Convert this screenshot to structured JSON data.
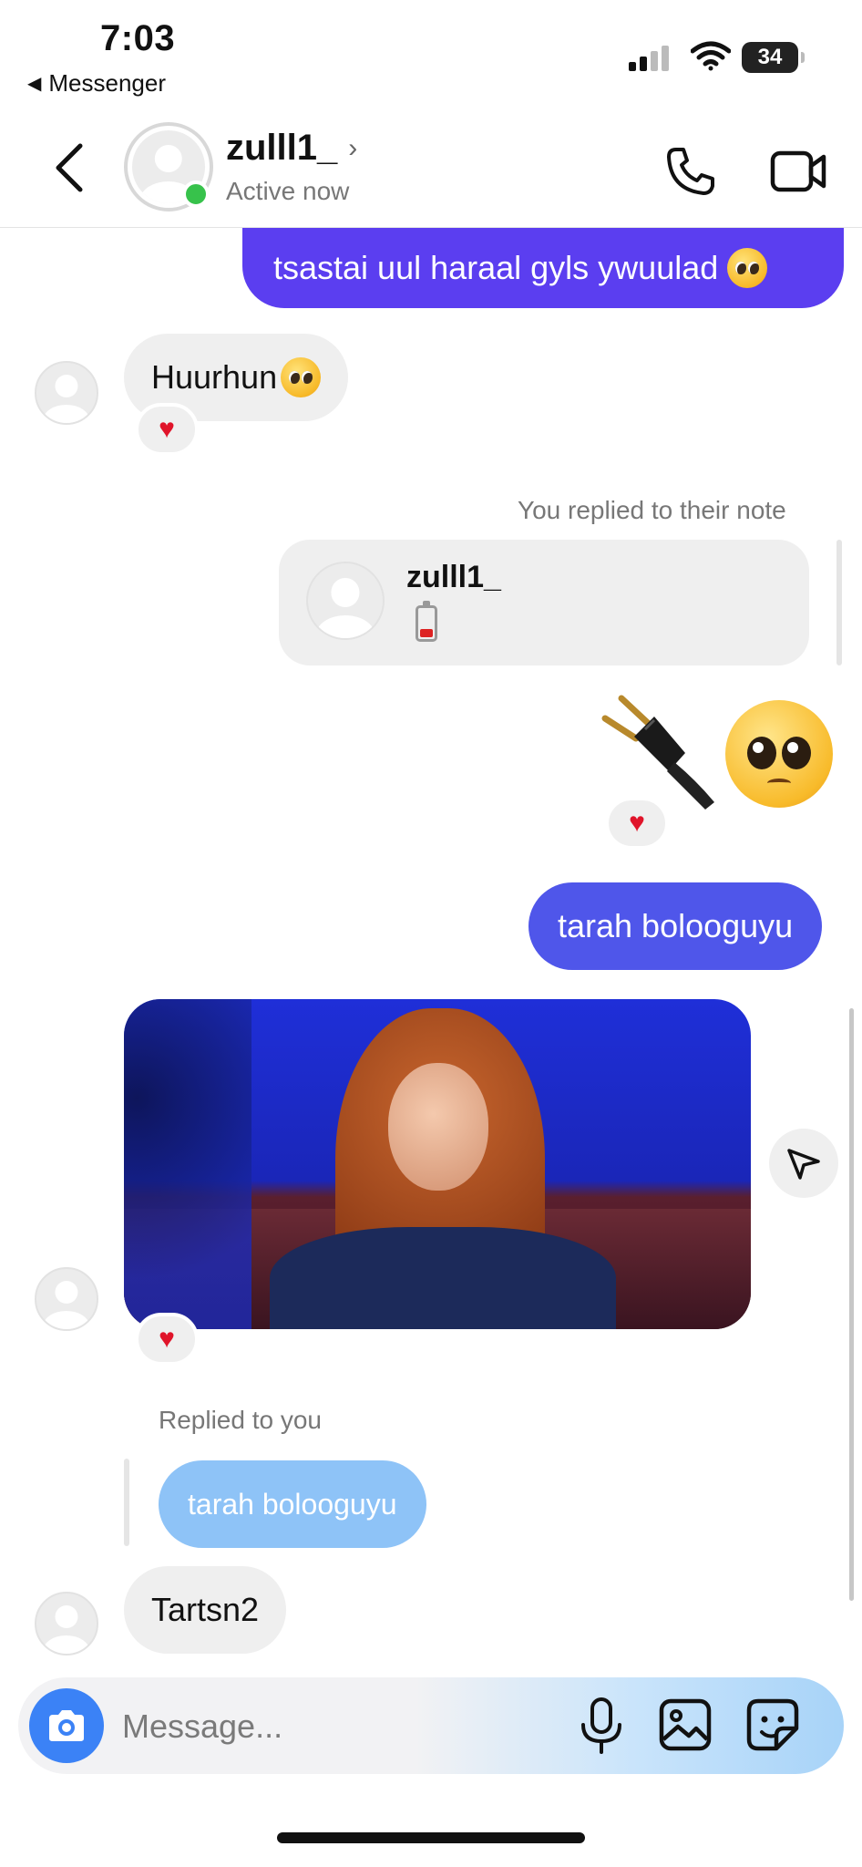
{
  "status_bar": {
    "time": "7:03",
    "back_app": "Messenger",
    "battery": "34"
  },
  "header": {
    "contact_name": "zulll1_",
    "status": "Active now",
    "icons": [
      "back-chevron-icon",
      "phone-icon",
      "video-camera-icon"
    ]
  },
  "thread": {
    "msg1": "tsastai uul haraal gyls ywuulad",
    "msg2": "Huurhun",
    "note_label": "You replied to their note",
    "note_author": "zulll1_",
    "msg4": "tarah bolooguyu",
    "reply_label": "Replied to you",
    "reply_quote": "tarah bolooguyu",
    "msg5": "Tartsn2",
    "reaction": "♥"
  },
  "composer": {
    "placeholder": "Message..."
  },
  "colors": {
    "sent_bubble": "#5b3ef0",
    "sent_bubble_2": "#4f56ea",
    "received_bubble": "#efefef",
    "online": "#37c24b",
    "camera_button": "#3b82f6",
    "reply_quote": "#8ec3f7"
  }
}
